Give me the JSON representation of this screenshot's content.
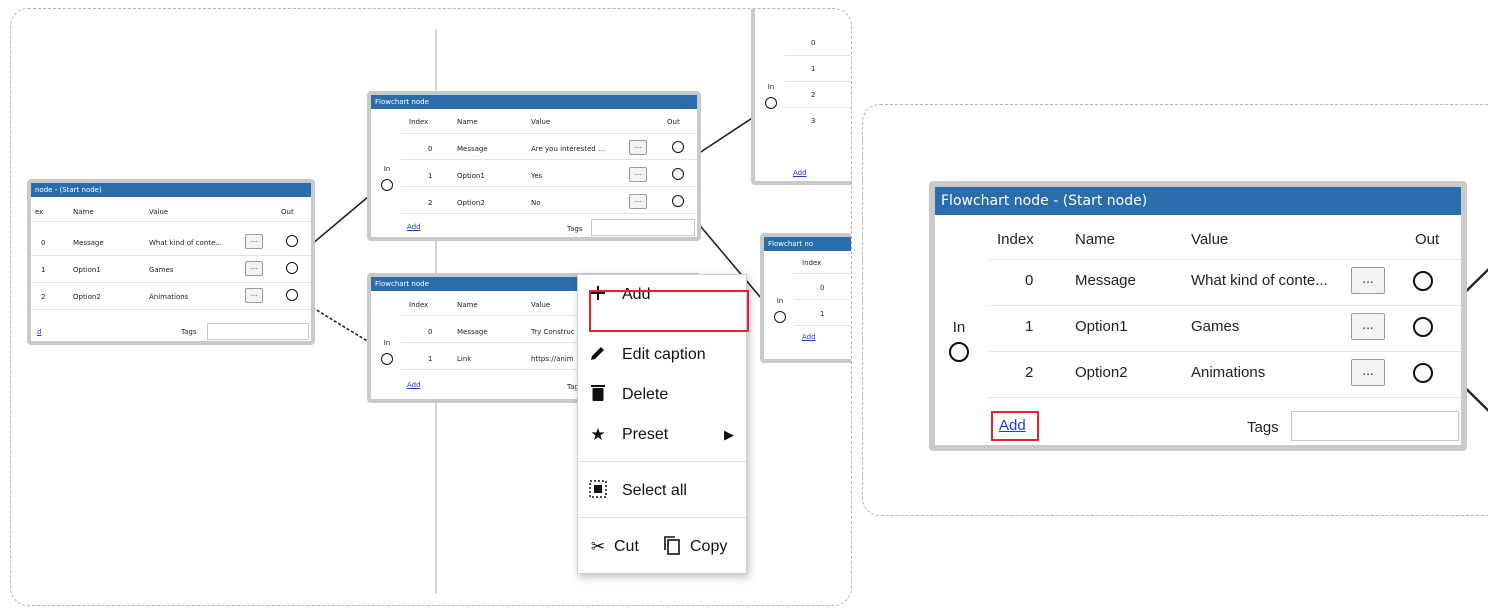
{
  "headers": {
    "index": "Index",
    "name": "Name",
    "value": "Value",
    "out": "Out"
  },
  "in_label": "In",
  "add_label": "Add",
  "tags_label": "Tags",
  "dots_label": "...",
  "start_node": {
    "title": "node - (Start node)",
    "index_header": "ex",
    "rows": [
      {
        "index": "0",
        "name": "Message",
        "value": "What kind of conte..."
      },
      {
        "index": "1",
        "name": "Option1",
        "value": "Games"
      },
      {
        "index": "2",
        "name": "Option2",
        "value": "Animations"
      }
    ],
    "add_label": "d"
  },
  "node_a": {
    "title": "Flowchart node",
    "rows": [
      {
        "index": "0",
        "name": "Message",
        "value": "Are you interested ..."
      },
      {
        "index": "1",
        "name": "Option1",
        "value": "Yes"
      },
      {
        "index": "2",
        "name": "Option2",
        "value": "No"
      }
    ]
  },
  "node_b": {
    "title": "Flowchart node",
    "rows": [
      {
        "index": "0",
        "name": "Message",
        "value": "Try Construc"
      },
      {
        "index": "1",
        "name": "Link",
        "value": "https://anim"
      }
    ],
    "tags_label": "Tags"
  },
  "node_c": {
    "indices": [
      "0",
      "1",
      "2",
      "3"
    ]
  },
  "node_d": {
    "title": "Flowchart no",
    "indices": [
      "0",
      "1"
    ]
  },
  "context_menu": {
    "items": [
      {
        "label": "Add",
        "icon": "plus-icon",
        "highlighted": true
      },
      {
        "label": "Edit caption",
        "icon": "pencil-icon"
      },
      {
        "label": "Delete",
        "icon": "trash-icon"
      },
      {
        "label": "Preset",
        "icon": "star-icon",
        "has_submenu": true
      },
      {
        "label": "Select all",
        "icon": "select-all-icon"
      },
      {
        "label": "Cut",
        "icon": "scissors-icon"
      },
      {
        "label": "Copy",
        "icon": "copy-icon"
      }
    ]
  },
  "big_node": {
    "title": "Flowchart node - (Start node)",
    "rows": [
      {
        "index": "0",
        "name": "Message",
        "value": "What kind of conte..."
      },
      {
        "index": "1",
        "name": "Option1",
        "value": "Games"
      },
      {
        "index": "2",
        "name": "Option2",
        "value": "Animations"
      }
    ],
    "add_highlighted": true
  },
  "colors": {
    "title_bar": "#2a6dab",
    "highlight": "#e0242e",
    "link": "#1f3ad6",
    "node_border": "#c9c9c9"
  }
}
